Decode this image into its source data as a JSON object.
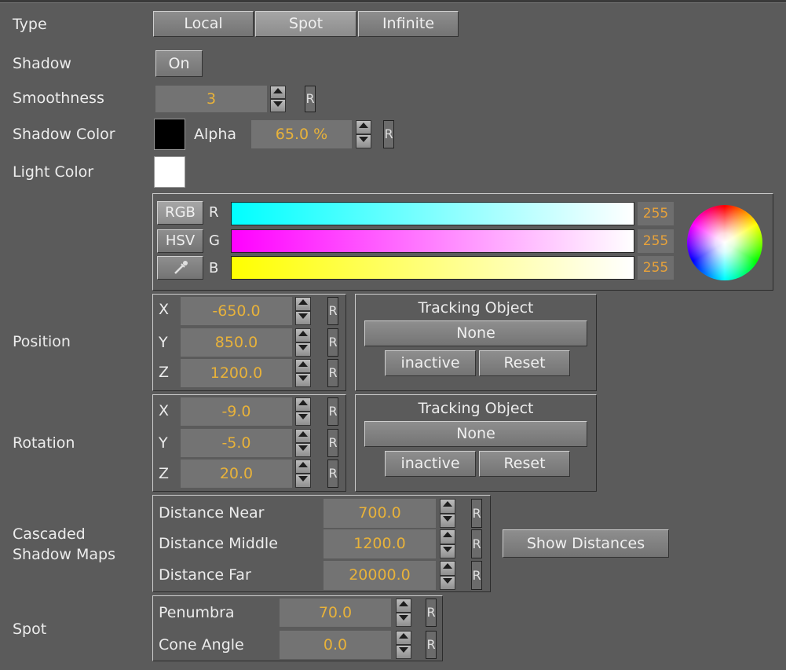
{
  "type_row": {
    "label": "Type",
    "options": [
      "Local",
      "Spot",
      "Infinite"
    ],
    "selected": "Spot"
  },
  "shadow_row": {
    "label": "Shadow",
    "toggle": "On"
  },
  "smoothness_row": {
    "label": "Smoothness",
    "value": "3",
    "reset": "R"
  },
  "shadow_color_row": {
    "label": "Shadow Color",
    "color": "#000000",
    "alpha_label": "Alpha",
    "alpha_value": "65.0 %",
    "reset": "R"
  },
  "light_color_row": {
    "label": "Light Color",
    "color": "#ffffff"
  },
  "color_picker": {
    "modes": [
      "RGB",
      "HSV"
    ],
    "eyedropper_icon": "eyedropper-icon",
    "channels": [
      {
        "name": "R",
        "value": "255"
      },
      {
        "name": "G",
        "value": "255"
      },
      {
        "name": "B",
        "value": "255"
      }
    ]
  },
  "position": {
    "label": "Position",
    "axes": [
      {
        "axis": "X",
        "value": "-650.0",
        "reset": "R"
      },
      {
        "axis": "Y",
        "value": "850.0",
        "reset": "R"
      },
      {
        "axis": "Z",
        "value": "1200.0",
        "reset": "R"
      }
    ],
    "tracking": {
      "title": "Tracking Object",
      "object": "None",
      "state": "inactive",
      "reset": "Reset"
    }
  },
  "rotation": {
    "label": "Rotation",
    "axes": [
      {
        "axis": "X",
        "value": "-9.0",
        "reset": "R"
      },
      {
        "axis": "Y",
        "value": "-5.0",
        "reset": "R"
      },
      {
        "axis": "Z",
        "value": "20.0",
        "reset": "R"
      }
    ],
    "tracking": {
      "title": "Tracking Object",
      "object": "None",
      "state": "inactive",
      "reset": "Reset"
    }
  },
  "cascaded": {
    "label_line1": "Cascaded",
    "label_line2": "Shadow Maps",
    "rows": [
      {
        "label": "Distance Near",
        "value": "700.0",
        "reset": "R"
      },
      {
        "label": "Distance Middle",
        "value": "1200.0",
        "reset": "R"
      },
      {
        "label": "Distance Far",
        "value": "20000.0",
        "reset": "R"
      }
    ],
    "show_button": "Show Distances"
  },
  "spot": {
    "label": "Spot",
    "rows": [
      {
        "label": "Penumbra",
        "value": "70.0",
        "reset": "R"
      },
      {
        "label": "Cone Angle",
        "value": "0.0",
        "reset": "R"
      }
    ]
  }
}
